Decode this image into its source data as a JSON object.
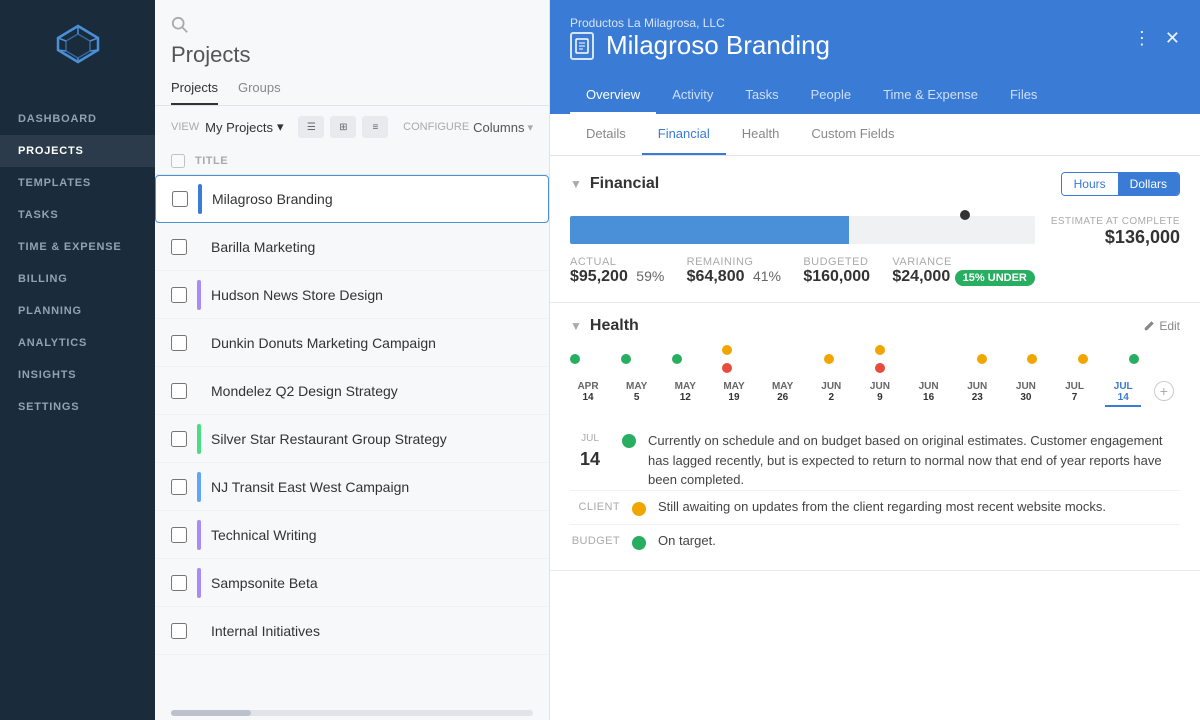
{
  "sidebar": {
    "nav_items": [
      {
        "id": "dashboard",
        "label": "DASHBOARD",
        "active": false
      },
      {
        "id": "projects",
        "label": "PROJECTS",
        "active": true
      },
      {
        "id": "templates",
        "label": "TEMPLATES",
        "active": false
      },
      {
        "id": "tasks",
        "label": "TASKS",
        "active": false
      },
      {
        "id": "time_expense",
        "label": "TIME & EXPENSE",
        "active": false
      },
      {
        "id": "billing",
        "label": "BILLING",
        "active": false
      },
      {
        "id": "planning",
        "label": "PLANNING",
        "active": false
      },
      {
        "id": "analytics",
        "label": "ANALYTICS",
        "active": false
      },
      {
        "id": "insights",
        "label": "INSIGHTS",
        "active": false
      },
      {
        "id": "settings",
        "label": "SETTINGS",
        "active": false
      }
    ]
  },
  "projects_panel": {
    "title": "Projects",
    "tabs": [
      {
        "label": "Projects",
        "active": true
      },
      {
        "label": "Groups",
        "active": false
      }
    ],
    "view_label": "VIEW",
    "view_value": "My Projects",
    "configure_label": "CONFIGURE",
    "configure_value": "Columns",
    "table_header": "TITLE",
    "projects": [
      {
        "name": "Milagroso Branding",
        "color": "#3a7bd5",
        "active": true
      },
      {
        "name": "Barilla Marketing",
        "color": null
      },
      {
        "name": "Hudson News Store Design",
        "color": "#a78bfa"
      },
      {
        "name": "Dunkin Donuts Marketing Campaign",
        "color": null
      },
      {
        "name": "Mondelez Q2 Design Strategy",
        "color": null
      },
      {
        "name": "Silver Star Restaurant Group Strategy",
        "color": "#4ade80"
      },
      {
        "name": "NJ Transit East West Campaign",
        "color": "#60a5fa"
      },
      {
        "name": "Technical Writing",
        "color": "#a78bfa"
      },
      {
        "name": "Sampsonite Beta",
        "color": "#a78bfa"
      },
      {
        "name": "Internal Initiatives",
        "color": null
      }
    ]
  },
  "main": {
    "company": "Productos La Milagrosa, LLC",
    "project_title": "Milagroso Branding",
    "tabs": [
      {
        "label": "Overview",
        "active": true
      },
      {
        "label": "Activity",
        "active": false
      },
      {
        "label": "Tasks",
        "active": false
      },
      {
        "label": "People",
        "active": false
      },
      {
        "label": "Time & Expense",
        "active": false
      },
      {
        "label": "Files",
        "active": false
      }
    ],
    "sub_tabs": [
      {
        "label": "Details",
        "active": false
      },
      {
        "label": "Financial",
        "active": true
      },
      {
        "label": "Health",
        "active": false
      },
      {
        "label": "Custom Fields",
        "active": false
      }
    ],
    "financial": {
      "section_title": "Financial",
      "toggle_hours": "Hours",
      "toggle_dollars": "Dollars",
      "toggle_active": "Dollars",
      "estimate_label": "ESTIMATE AT COMPLETE",
      "estimate_value": "$136,000",
      "actual_label": "ACTUAL",
      "actual_value": "$95,200",
      "actual_pct": "59%",
      "remaining_label": "REMAINING",
      "remaining_value": "$64,800",
      "remaining_pct": "41%",
      "budgeted_label": "BUDGETED",
      "budgeted_value": "$160,000",
      "variance_label": "VARIANCE",
      "variance_value": "$24,000",
      "variance_badge": "15% UNDER",
      "bar_fill_pct": 59,
      "marker_pct": 85
    },
    "health": {
      "section_title": "Health",
      "edit_label": "Edit",
      "timeline_dates": [
        {
          "month": "APR",
          "day": "14",
          "active": false,
          "dots": [
            {
              "type": "green"
            }
          ]
        },
        {
          "month": "MAY",
          "day": "5",
          "active": false,
          "dots": [
            {
              "type": "green"
            }
          ]
        },
        {
          "month": "MAY",
          "day": "12",
          "active": false,
          "dots": [
            {
              "type": "green"
            }
          ]
        },
        {
          "month": "MAY",
          "day": "19",
          "active": false,
          "dots": [
            {
              "type": "yellow"
            }
          ]
        },
        {
          "month": "MAY",
          "day": "26",
          "active": false,
          "dots": [
            {
              "type": "red"
            }
          ]
        },
        {
          "month": "JUN",
          "day": "2",
          "active": false,
          "dots": [
            {
              "type": "yellow"
            }
          ]
        },
        {
          "month": "JUN",
          "day": "9",
          "active": false,
          "dots": [
            {
              "type": "yellow"
            }
          ]
        },
        {
          "month": "JUN",
          "day": "16",
          "active": false,
          "dots": [
            {
              "type": "red"
            }
          ]
        },
        {
          "month": "JUN",
          "day": "23",
          "active": false,
          "dots": [
            {
              "type": "yellow"
            }
          ]
        },
        {
          "month": "JUN",
          "day": "30",
          "active": false,
          "dots": [
            {
              "type": "yellow"
            }
          ]
        },
        {
          "month": "JUL",
          "day": "7",
          "active": false,
          "dots": [
            {
              "type": "yellow"
            }
          ]
        },
        {
          "month": "JUL",
          "day": "14",
          "active": true,
          "dots": [
            {
              "type": "green"
            }
          ]
        }
      ],
      "note_month": "JUL",
      "note_day": "14",
      "note_dot_color": "green",
      "note_text": "Currently on schedule and on budget based on original estimates. Customer engagement has lagged recently, but is expected to return to normal now that end of year reports have been completed.",
      "sub_items": [
        {
          "label": "CLIENT",
          "dot": "yellow",
          "text": "Still awaiting on updates from the client regarding most recent website mocks."
        },
        {
          "label": "BUDGET",
          "dot": "green",
          "text": "On target."
        }
      ]
    }
  }
}
